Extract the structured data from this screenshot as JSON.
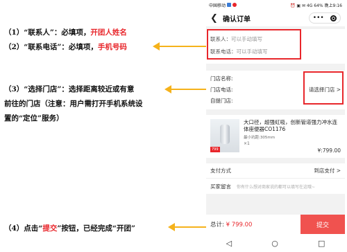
{
  "annotations": {
    "note1": {
      "prefix": "（1）“联系人”：必填项，",
      "highlight": "开团人姓名"
    },
    "note2": {
      "prefix": "（2）“联系电话”：必填项，",
      "highlight": "手机号码"
    },
    "note3": {
      "line1": "（3）“选择门店”：选择距离较近或有意",
      "line2": "前往的门店（注意：用户需打开手机系统设",
      "line3": "置的“定位”服务）"
    },
    "note4": {
      "prefix": "（4）点击“",
      "highlight": "提交",
      "suffix": "”按钮，已经完成“开团”"
    },
    "arrow_color": "#f5b21b",
    "highlight_color": "#e8262b"
  },
  "phone": {
    "status_bar": {
      "carrier": "中国移动",
      "right": "⏰ ▣ ✉ 4G 64% 晚上9:16"
    },
    "header": {
      "back_icon": "back-arrow-icon",
      "title": "确认订单",
      "more": "•••"
    },
    "contact": {
      "name_label": "联系人：",
      "name_placeholder": "可以手动填写",
      "phone_label": "联系电话：",
      "phone_placeholder": "可以手动填写"
    },
    "store": {
      "name_label": "门店名称:",
      "phone_label": "门店电话:",
      "pickup_label": "自提门店:",
      "select_label": "请选择门店 >"
    },
    "product": {
      "name": "大口径，超强虹吸，创新管道强力冲水连体座便器CO1176",
      "spec": "最小坑距:305mm",
      "qty": "×1",
      "price": "¥:799.00",
      "thumb_tag": "799"
    },
    "payment": {
      "label": "支付方式",
      "value": "到店支付 >"
    },
    "message": {
      "label": "买家留言",
      "placeholder": "你有什么想对商家说的都可以填写在这哦~"
    },
    "footer": {
      "total_label": "总计:",
      "total_amount": "¥ 799.00",
      "submit": "提交"
    },
    "navbar": {
      "back": "◁",
      "home": "○",
      "recent": "□"
    }
  }
}
